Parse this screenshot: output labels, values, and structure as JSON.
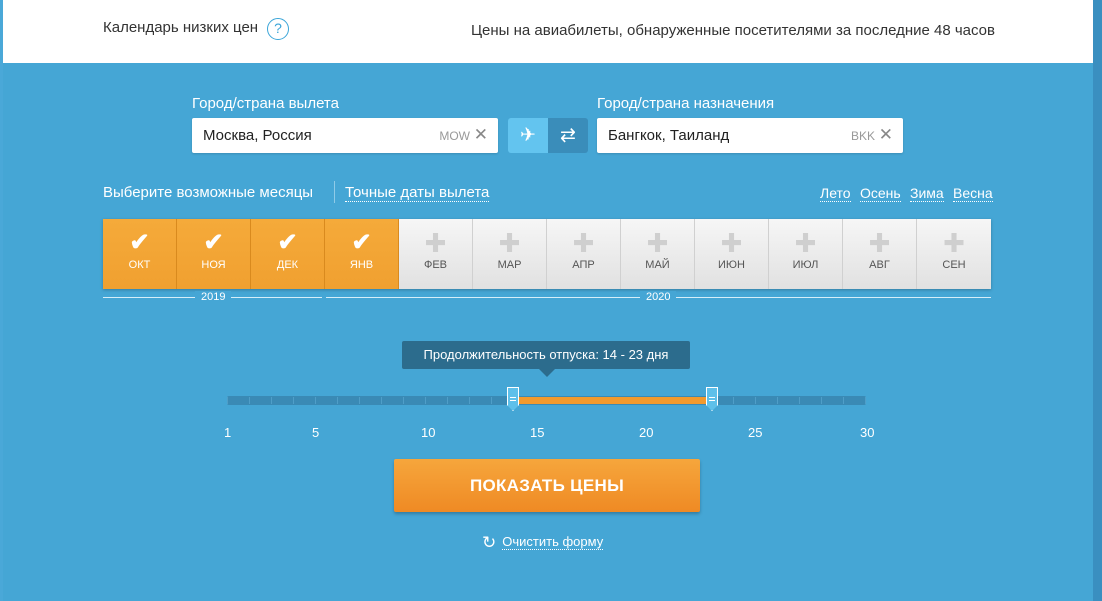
{
  "header": {
    "title": "Календарь низких цен",
    "help_icon": "?",
    "subtitle": "Цены на авиабилеты, обнаруженные посетителями за последние 48 часов"
  },
  "origin": {
    "label": "Город/страна вылета",
    "value": "Москва, Россия",
    "code": "MOW",
    "clear": "✕"
  },
  "destination": {
    "label": "Город/страна назначения",
    "value": "Бангкок, Таиланд",
    "code": "BKK",
    "clear": "✕"
  },
  "trip_type": {
    "one_way_icon": "✈",
    "round_trip_icon": "⇄"
  },
  "months_mode": {
    "possible": "Выберите возможные месяцы",
    "exact": "Точные даты вылета"
  },
  "seasons": [
    "Лето",
    "Осень",
    "Зима",
    "Весна"
  ],
  "months": [
    {
      "label": "ОКТ",
      "selected": true
    },
    {
      "label": "НОЯ",
      "selected": true
    },
    {
      "label": "ДЕК",
      "selected": true
    },
    {
      "label": "ЯНВ",
      "selected": true
    },
    {
      "label": "ФЕВ",
      "selected": false
    },
    {
      "label": "МАР",
      "selected": false
    },
    {
      "label": "АПР",
      "selected": false
    },
    {
      "label": "МАЙ",
      "selected": false
    },
    {
      "label": "ИЮН",
      "selected": false
    },
    {
      "label": "ИЮЛ",
      "selected": false
    },
    {
      "label": "АВГ",
      "selected": false
    },
    {
      "label": "СЕН",
      "selected": false
    }
  ],
  "years": [
    "2019",
    "2020"
  ],
  "duration": {
    "tooltip": "Продолжительность отпуска: 14 - 23 дня",
    "min": 1,
    "max": 30,
    "from": 14,
    "to": 23,
    "scale": [
      "1",
      "5",
      "10",
      "15",
      "20",
      "25",
      "30"
    ]
  },
  "actions": {
    "show_prices": "ПОКАЗАТЬ ЦЕНЫ",
    "clear_form": "Очистить форму",
    "clear_icon": "↻"
  },
  "colors": {
    "background": "#45a6d5",
    "accent": "#f29a2e",
    "dark_tooltip": "#2c6c8d"
  }
}
